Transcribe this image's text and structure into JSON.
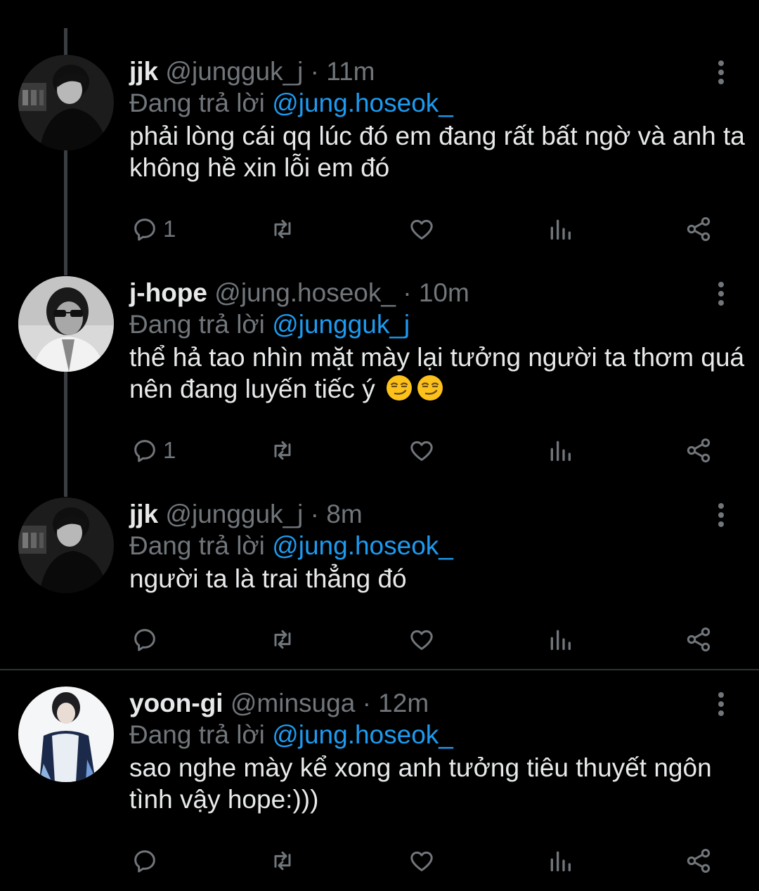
{
  "tweets": [
    {
      "name": "jjk",
      "handle": "@jungguk_j",
      "time": "· 11m",
      "replying_prefix": "Đang trả lời",
      "replying_to": "@jung.hoseok_",
      "text": "phải lòng cái qq lúc đó em đang rất bất ngờ và anh ta không hề xin lỗi em đó",
      "reply_count": "1"
    },
    {
      "name": "j-hope",
      "handle": "@jung.hoseok_",
      "time": "· 10m",
      "replying_prefix": "Đang trả lời",
      "replying_to": "@jungguk_j",
      "text": "thể hả tao nhìn mặt mày lại tưởng người ta thơm quá nên đang luyến tiếc ý",
      "reply_count": "1"
    },
    {
      "name": "jjk",
      "handle": "@jungguk_j",
      "time": "· 8m",
      "replying_prefix": "Đang trả lời",
      "replying_to": "@jung.hoseok_",
      "text": "người ta là trai thẳng đó",
      "reply_count": ""
    },
    {
      "name": "yoon-gi",
      "handle": "@minsuga",
      "time": "· 12m",
      "replying_prefix": "Đang trả lời",
      "replying_to": "@jung.hoseok_",
      "text": "sao nghe mày kể xong anh tưởng tiêu thuyết ngôn tình vậy hope:)))",
      "reply_count": ""
    }
  ],
  "icons": {
    "reply": "reply-icon",
    "retweet": "retweet-icon",
    "like": "heart-icon",
    "views": "analytics-icon",
    "share": "share-icon",
    "more": "more-options-icon",
    "emoji": "smirking-face-emoji"
  },
  "colors": {
    "background": "#000000",
    "text": "#e7e9ea",
    "muted": "#71767b",
    "link": "#1d9bf0",
    "thread_line": "#3a3d41"
  }
}
